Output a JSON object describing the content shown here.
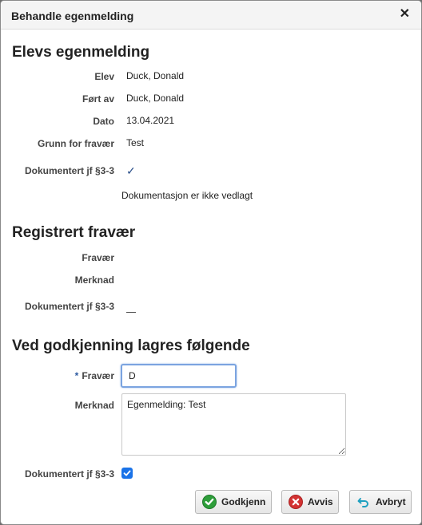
{
  "dialog": {
    "title": "Behandle egenmelding",
    "close_glyph": "✕"
  },
  "elevs_egenmelding": {
    "heading": "Elevs egenmelding",
    "rows": [
      {
        "label": "Elev",
        "value": "Duck, Donald"
      },
      {
        "label": "Ført av",
        "value": "Duck, Donald"
      },
      {
        "label": "Dato",
        "value": "13.04.2021"
      },
      {
        "label": "Grunn for fravær",
        "value": "Test"
      }
    ],
    "dokumentert_label": "Dokumentert jf §3-3",
    "dokumentert_value": "✓",
    "dokumentasjon_note": "Dokumentasjon er ikke vedlagt"
  },
  "registrert_fravaer": {
    "heading": "Registrert fravær",
    "fravaer_label": "Fravær",
    "merknad_label": "Merknad",
    "dokumentert_label": "Dokumentert jf §3-3"
  },
  "ved_godkjenning": {
    "heading": "Ved godkjenning lagres følgende",
    "required_marker": "*",
    "fravaer_label": "Fravær",
    "fravaer_value": "D",
    "merknad_label": "Merknad",
    "merknad_value": "Egenmelding: Test",
    "dokumentert_label": "Dokumentert jf §3-3",
    "dokumentert_checked": true
  },
  "buttons": {
    "godkjenn": "Godkjenn",
    "avvis": "Avvis",
    "avbryt": "Avbryt"
  },
  "icons": {
    "godkjenn_icon": "check-circle-icon",
    "avvis_icon": "x-circle-icon",
    "avbryt_icon": "undo-arrow-icon"
  },
  "colors": {
    "accent": "#1a73e8",
    "focus_border": "#7ba4e0",
    "approve_green": "#2e9e3a",
    "reject_red": "#d33232",
    "undo_teal": "#1fa0c0"
  }
}
